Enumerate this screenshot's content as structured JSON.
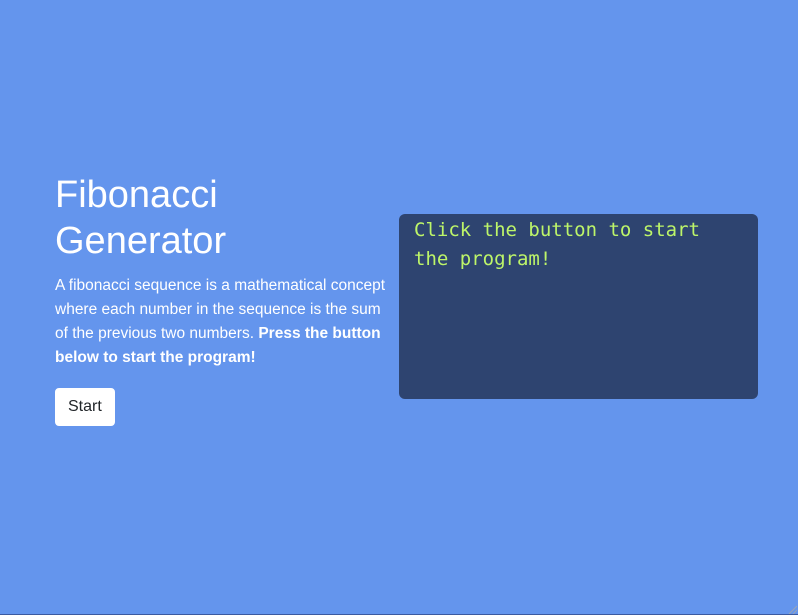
{
  "page": {
    "title_line1": "Fibonacci",
    "title_line2": "Generator",
    "description_plain": "A fibonacci sequence is a mathematical concept where each number in the sequence is the sum of the previous two numbers. ",
    "description_bold": "Press the button below to start the program!",
    "start_button_label": "Start"
  },
  "console": {
    "output_text": "Click the button to start the program!"
  },
  "colors": {
    "background": "#6495ed",
    "console_background": "#2e4470",
    "console_text": "#bdf569",
    "button_background": "#ffffff"
  }
}
